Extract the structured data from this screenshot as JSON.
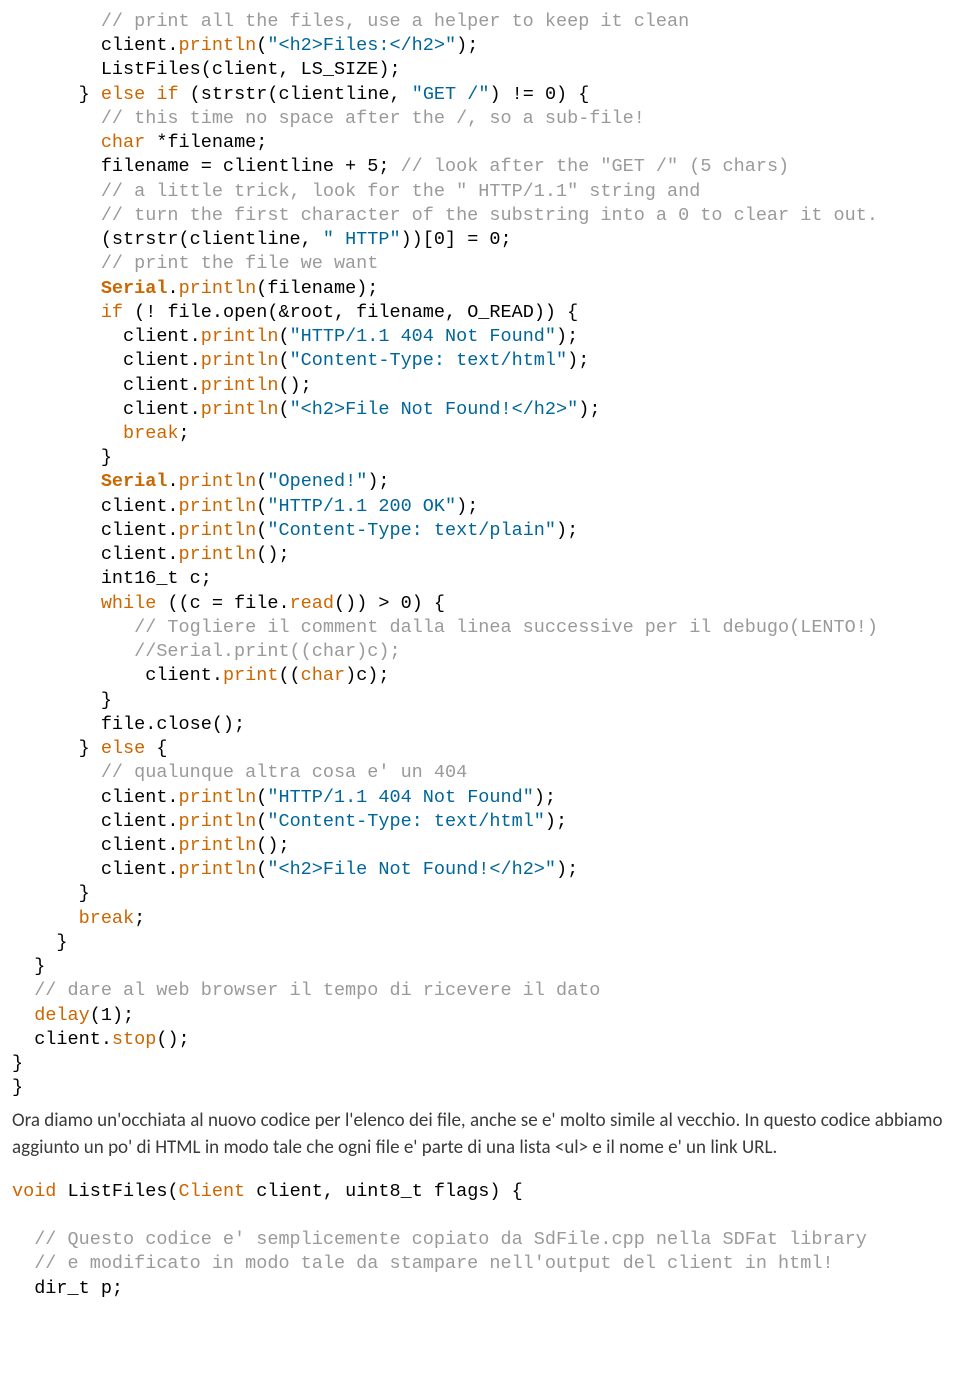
{
  "code1": {
    "l01a": "        // print all the files, use a helper to keep it clean",
    "l02a": "        client.",
    "l02b": "println",
    "l02c": "(",
    "l02d": "\"<h2>Files:</h2>\"",
    "l02e": ");",
    "l03a": "        ListFiles(client, LS_SIZE);",
    "l04a": "      } ",
    "l04b": "else",
    "l04c": " ",
    "l04d": "if",
    "l04e": " (strstr(clientline, ",
    "l04f": "\"GET /\"",
    "l04g": ") != 0) {",
    "l05a": "        // this time no space after the /, so a sub-file!",
    "l06a": "        ",
    "l06b": "char",
    "l06c": " *filename;",
    "l07a": "        filename = clientline + 5; ",
    "l07b": "// look after the \"GET /\" (5 chars)",
    "l08a": "        // a little trick, look for the \" HTTP/1.1\" string and",
    "l09a": "        // turn the first character of the substring into a 0 to clear it out.",
    "l10a": "        (strstr(clientline, ",
    "l10b": "\" HTTP\"",
    "l10c": "))[0] = 0;",
    "l11a": "        // print the file we want",
    "l12a": "        ",
    "l12b": "Serial",
    "l12c": ".",
    "l12d": "println",
    "l12e": "(filename);",
    "l13a": "        ",
    "l13b": "if",
    "l13c": " (! file.open(&root, filename, O_READ)) {",
    "l14a": "          client.",
    "l14b": "println",
    "l14c": "(",
    "l14d": "\"HTTP/1.1 404 Not Found\"",
    "l14e": ");",
    "l15a": "          client.",
    "l15b": "println",
    "l15c": "(",
    "l15d": "\"Content-Type: text/html\"",
    "l15e": ");",
    "l16a": "          client.",
    "l16b": "println",
    "l16c": "();",
    "l17a": "          client.",
    "l17b": "println",
    "l17c": "(",
    "l17d": "\"<h2>File Not Found!</h2>\"",
    "l17e": ");",
    "l18a": "          ",
    "l18b": "break",
    "l18c": ";",
    "l19a": "        }",
    "l20a": "        ",
    "l20b": "Serial",
    "l20c": ".",
    "l20d": "println",
    "l20e": "(",
    "l20f": "\"Opened!\"",
    "l20g": ");",
    "l21a": "        client.",
    "l21b": "println",
    "l21c": "(",
    "l21d": "\"HTTP/1.1 200 OK\"",
    "l21e": ");",
    "l22a": "        client.",
    "l22b": "println",
    "l22c": "(",
    "l22d": "\"Content-Type: text/plain\"",
    "l22e": ");",
    "l23a": "        client.",
    "l23b": "println",
    "l23c": "();",
    "l24a": "        int16_t c;",
    "l25a": "        ",
    "l25b": "while",
    "l25c": " ((c = file.",
    "l25d": "read",
    "l25e": "()) > 0) {",
    "l26a": "           // Togliere il comment dalla linea successive per il debugo(LENTO!)",
    "l27a": "           //Serial.print((char)c);",
    "l28a": "            client.",
    "l28b": "print",
    "l28c": "((",
    "l28d": "char",
    "l28e": ")c);",
    "l29a": "        }",
    "l30a": "        file.close();",
    "l31a": "      } ",
    "l31b": "else",
    "l31c": " {",
    "l32a": "        // qualunque altra cosa e' un 404",
    "l33a": "        client.",
    "l33b": "println",
    "l33c": "(",
    "l33d": "\"HTTP/1.1 404 Not Found\"",
    "l33e": ");",
    "l34a": "        client.",
    "l34b": "println",
    "l34c": "(",
    "l34d": "\"Content-Type: text/html\"",
    "l34e": ");",
    "l35a": "        client.",
    "l35b": "println",
    "l35c": "();",
    "l36a": "        client.",
    "l36b": "println",
    "l36c": "(",
    "l36d": "\"<h2>File Not Found!</h2>\"",
    "l36e": ");",
    "l37a": "      }",
    "l38a": "      ",
    "l38b": "break",
    "l38c": ";",
    "l39a": "    }",
    "l40a": "  }",
    "l41a": "  // dare al web browser il tempo di ricevere il dato",
    "l42a": "  ",
    "l42b": "delay",
    "l42c": "(1);",
    "l43a": "  client.",
    "l43b": "stop",
    "l43c": "();",
    "l44a": "}",
    "l45a": "}"
  },
  "prose1": "Ora diamo un'occhiata al nuovo codice per l'elenco dei file, anche se e' molto simile al vecchio. In questo codice abbiamo aggiunto un po' di HTML in modo tale che ogni file e' parte di una lista <ul> e il nome e' un link URL.",
  "code2": {
    "l01a": "void",
    "l01b": " ListFiles(",
    "l01c": "Client",
    "l01d": " client, uint8_t flags) {",
    "blank": " ",
    "l02a": "  // Questo codice e' semplicemente copiato da SdFile.cpp nella SDFat library",
    "l03a": "  // e modificato in modo tale da stampare nell'output del client in html!",
    "l04a": "  dir_t p;"
  }
}
